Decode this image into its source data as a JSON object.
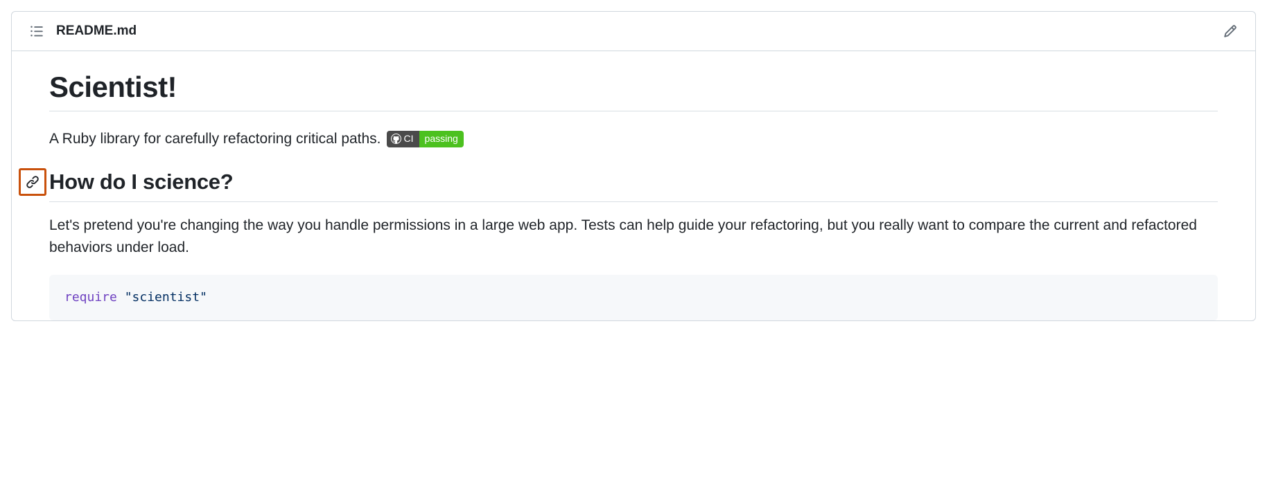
{
  "header": {
    "filename": "README.md"
  },
  "content": {
    "title": "Scientist!",
    "description": "A Ruby library for carefully refactoring critical paths.",
    "badge": {
      "left": "CI",
      "right": "passing"
    },
    "subheading": "How do I science?",
    "intro": "Let's pretend you're changing the way you handle permissions in a large web app. Tests can help guide your refactoring, but you really want to compare the current and refactored behaviors under load.",
    "code": {
      "keyword": "require",
      "string": "\"scientist\""
    }
  }
}
